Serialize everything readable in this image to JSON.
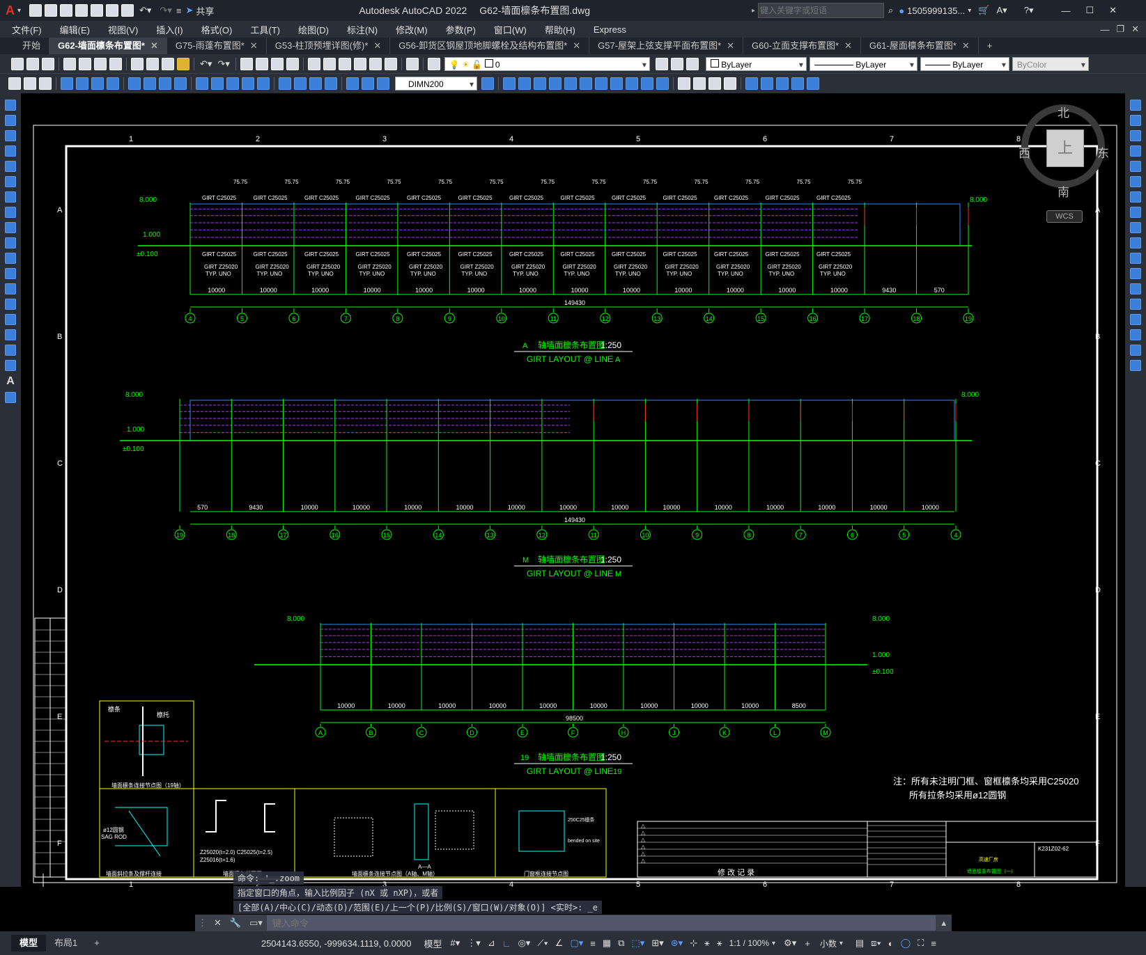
{
  "titlebar": {
    "app_title": "Autodesk AutoCAD 2022",
    "file_title": "G62-墙面檩条布置图.dwg",
    "share_label": "共享",
    "search_placeholder": "键入关键字或短语",
    "user": "1505999135...",
    "icons": [
      "autocad-logo-icon",
      "new-icon",
      "open-icon",
      "save-icon",
      "saveas-icon",
      "open-web-icon",
      "save-web-icon",
      "print-icon",
      "undo-icon",
      "redo-icon",
      "share-icon",
      "search-icon",
      "user-icon",
      "cart-icon",
      "a360-icon",
      "help-icon",
      "minimize-icon",
      "maximize-icon",
      "close-icon"
    ]
  },
  "menu": [
    "文件(F)",
    "编辑(E)",
    "视图(V)",
    "插入(I)",
    "格式(O)",
    "工具(T)",
    "绘图(D)",
    "标注(N)",
    "修改(M)",
    "参数(P)",
    "窗口(W)",
    "帮助(H)",
    "Express"
  ],
  "tabs": [
    {
      "label": "开始",
      "active": false
    },
    {
      "label": "G62-墙面檩条布置图*",
      "active": true
    },
    {
      "label": "G75-雨蓬布置图*",
      "active": false
    },
    {
      "label": "G53-柱顶预埋详图(修)*",
      "active": false
    },
    {
      "label": "G56-卸货区钢屋顶地脚螺栓及结构布置图*",
      "active": false
    },
    {
      "label": "G57-屋架上弦支撑平面布置图*",
      "active": false
    },
    {
      "label": "G60-立面支撑布置图*",
      "active": false
    },
    {
      "label": "G61-屋面檩条布置图*",
      "active": false
    }
  ],
  "properties": {
    "layer": "0",
    "color": "ByLayer",
    "linetype": "ByLayer",
    "lineweight": "ByLayer",
    "plotstyle": "ByColor",
    "dimstyle": "DIMN200"
  },
  "compass": {
    "north": "北",
    "south": "南",
    "east": "东",
    "west": "西",
    "top": "上",
    "wcs": "WCS"
  },
  "drawing": {
    "border_cols": [
      "1",
      "2",
      "3",
      "4",
      "5",
      "6",
      "7",
      "8"
    ],
    "border_rows": [
      "A",
      "B",
      "C",
      "D",
      "E",
      "F"
    ],
    "elev_a": {
      "title_cn": "轴墙面檩条布置图",
      "title_scale": "1:250",
      "title_en": "GIRT LAYOUT @ LINE",
      "axis": "A",
      "level_top": "8.000",
      "level_mid": "1.000",
      "level_base": "±0.100",
      "girt": "GIRT C25025",
      "sag": "75.75",
      "z_note": "GIRT Z25020",
      "typ": "TYP. UNO",
      "total": "149430",
      "bays": [
        "10000",
        "10000",
        "10000",
        "10000",
        "10000",
        "10000",
        "10000",
        "10000",
        "10000",
        "10000",
        "10000",
        "10000",
        "10000",
        "9430",
        "570"
      ],
      "axes": [
        "4",
        "5",
        "6",
        "7",
        "8",
        "9",
        "10",
        "11",
        "12",
        "13",
        "14",
        "15",
        "16",
        "17",
        "18",
        "19"
      ]
    },
    "elev_m": {
      "title_cn": "轴墙面檩条布置图",
      "title_scale": "1:250",
      "title_en": "GIRT LAYOUT @ LINE",
      "axis": "M",
      "level_top": "8.000",
      "level_mid": "1.000",
      "level_base": "±0.100",
      "total": "149430",
      "bays": [
        "570",
        "9430",
        "10000",
        "10000",
        "10000",
        "10000",
        "10000",
        "10000",
        "10000",
        "10000",
        "10000",
        "10000",
        "10000",
        "10000",
        "10000"
      ],
      "axes": [
        "19",
        "18",
        "17",
        "16",
        "15",
        "14",
        "13",
        "12",
        "11",
        "10",
        "9",
        "8",
        "7",
        "6",
        "5",
        "4"
      ]
    },
    "elev_19": {
      "title_cn": "轴墙面檩条布置图",
      "title_scale": "1:250",
      "title_en": "GIRT LAYOUT @ LINE",
      "axis": "19",
      "level_top": "8.000",
      "level_mid": "1.000",
      "level_base": "±0.100",
      "total": "98500",
      "bays": [
        "10000",
        "10000",
        "10000",
        "10000",
        "10000",
        "10000",
        "10000",
        "10000",
        "10000",
        "8500"
      ],
      "axes": [
        "A",
        "B",
        "C",
        "D",
        "E",
        "F",
        "H",
        "J",
        "K",
        "L",
        "M"
      ]
    },
    "notes": [
      "注：所有未注明门框、窗框檩条均采用C25020",
      "所有拉条均采用ø12圆钢"
    ],
    "details": [
      "墙面檩条连接节点图（19轴）",
      "墙面斜拉条及撑杆连接",
      "墙面檩条截面图",
      "墙面檩条连接节点图（A轴、M轴）",
      "门窗框连接节点图"
    ],
    "detail_text": [
      "檩条",
      "檩托",
      "ø12圆钢",
      "SAG ROD",
      "Z25020(t=2.0) C25025(t=2.5)",
      "Z25016(t=1.6)",
      "A—A",
      "250C25檩条",
      "bended on site"
    ],
    "titleblock": {
      "revision": "修  改  记  录",
      "drawing_no": "K231Z02-62",
      "client": "高速厂房",
      "drawing_name": "墙面檩条布置图（一）"
    }
  },
  "command": {
    "history": [
      "命令: '_.zoom",
      "指定窗口的角点，输入比例因子 (nX 或 nXP)，或者",
      "[全部(A)/中心(C)/动态(D)/范围(E)/上一个(P)/比例(S)/窗口(W)/对象(O)] <实时>: _e"
    ],
    "placeholder": "键入命令"
  },
  "status": {
    "model_tab": "模型",
    "layout_tab": "布局1",
    "coords": "2504143.6550, -999634.1119, 0.0000",
    "space": "模型",
    "scale": "1:1 / 100%",
    "units": "小数"
  }
}
